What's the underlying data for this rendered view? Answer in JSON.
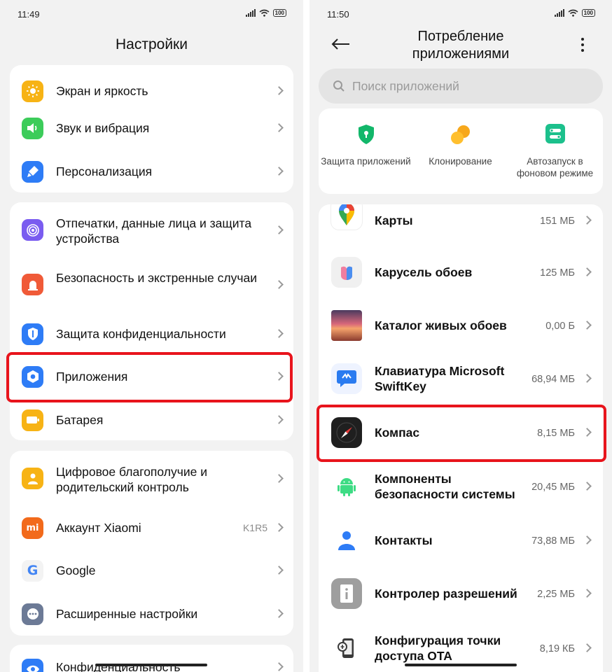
{
  "left": {
    "status_time": "11:49",
    "battery": "100",
    "title": "Настройки",
    "groups": [
      {
        "items": [
          {
            "label": "Экран и яркость",
            "icon": "sun-icon",
            "color": "#f7b315"
          },
          {
            "label": "Звук и вибрация",
            "icon": "speaker-icon",
            "color": "#3ccc5a"
          },
          {
            "label": "Персонализация",
            "icon": "brush-icon",
            "color": "#2e7cf6"
          }
        ]
      },
      {
        "items": [
          {
            "label": "Отпечатки, данные лица и защита устройства",
            "icon": "fingerprint-icon",
            "color": "#7a5cf0"
          },
          {
            "label": "Безопасность и экстренные случаи",
            "icon": "alarm-icon",
            "color": "#f05a38"
          },
          {
            "label": "Защита конфиденциальности",
            "icon": "privacy-shield-icon",
            "color": "#2e7cf6"
          },
          {
            "label": "Приложения",
            "icon": "apps-gear-icon",
            "color": "#2e7cf6"
          },
          {
            "label": "Батарея",
            "icon": "battery-icon",
            "color": "#f7b315"
          }
        ]
      },
      {
        "items": [
          {
            "label": "Цифровое благополучие и родительский контроль",
            "icon": "wellbeing-icon",
            "color": "#f7b315"
          },
          {
            "label": "Аккаунт Xiaomi",
            "icon": "mi-icon",
            "color": "#f26a1b",
            "value": "K1R5"
          },
          {
            "label": "Google",
            "icon": "google-icon",
            "color": "#ffffff"
          },
          {
            "label": "Расширенные настройки",
            "icon": "more-icon",
            "color": "#6c7a96"
          }
        ]
      },
      {
        "items": [
          {
            "label": "Конфиденциальность",
            "icon": "eye-icon",
            "color": "#2e7cf6"
          }
        ]
      }
    ]
  },
  "right": {
    "status_time": "11:50",
    "battery": "100",
    "title_line1": "Потребление",
    "title_line2": "приложениями",
    "search_placeholder": "Поиск приложений",
    "quick": [
      {
        "label": "Защита приложений",
        "icon": "shield-icon"
      },
      {
        "label": "Клонирование",
        "icon": "clone-icon"
      },
      {
        "label": "Автозапуск в фоновом режиме",
        "icon": "autostart-icon"
      }
    ],
    "apps": [
      {
        "name": "Карты",
        "size": "151 МБ",
        "icon": "maps-icon"
      },
      {
        "name": "Карусель обоев",
        "size": "125 МБ",
        "icon": "wallpaper-carousel-icon"
      },
      {
        "name": "Каталог живых обоев",
        "size": "0,00 Б",
        "icon": "live-wallpaper-icon"
      },
      {
        "name": "Клавиатура Microsoft SwiftKey",
        "size": "68,94 МБ",
        "icon": "swiftkey-icon"
      },
      {
        "name": "Компас",
        "size": "8,15 МБ",
        "icon": "compass-icon"
      },
      {
        "name": "Компоненты безопасности системы",
        "size": "20,45 МБ",
        "icon": "android-icon"
      },
      {
        "name": "Контакты",
        "size": "73,88 МБ",
        "icon": "contacts-icon"
      },
      {
        "name": "Контролер разрешений",
        "size": "2,25 МБ",
        "icon": "permissions-icon"
      },
      {
        "name": "Конфигурация точки доступа OTA",
        "size": "8,19 КБ",
        "icon": "ota-icon"
      }
    ]
  },
  "colors": {
    "highlight": "#e8141c",
    "background": "#f2f2f2"
  }
}
